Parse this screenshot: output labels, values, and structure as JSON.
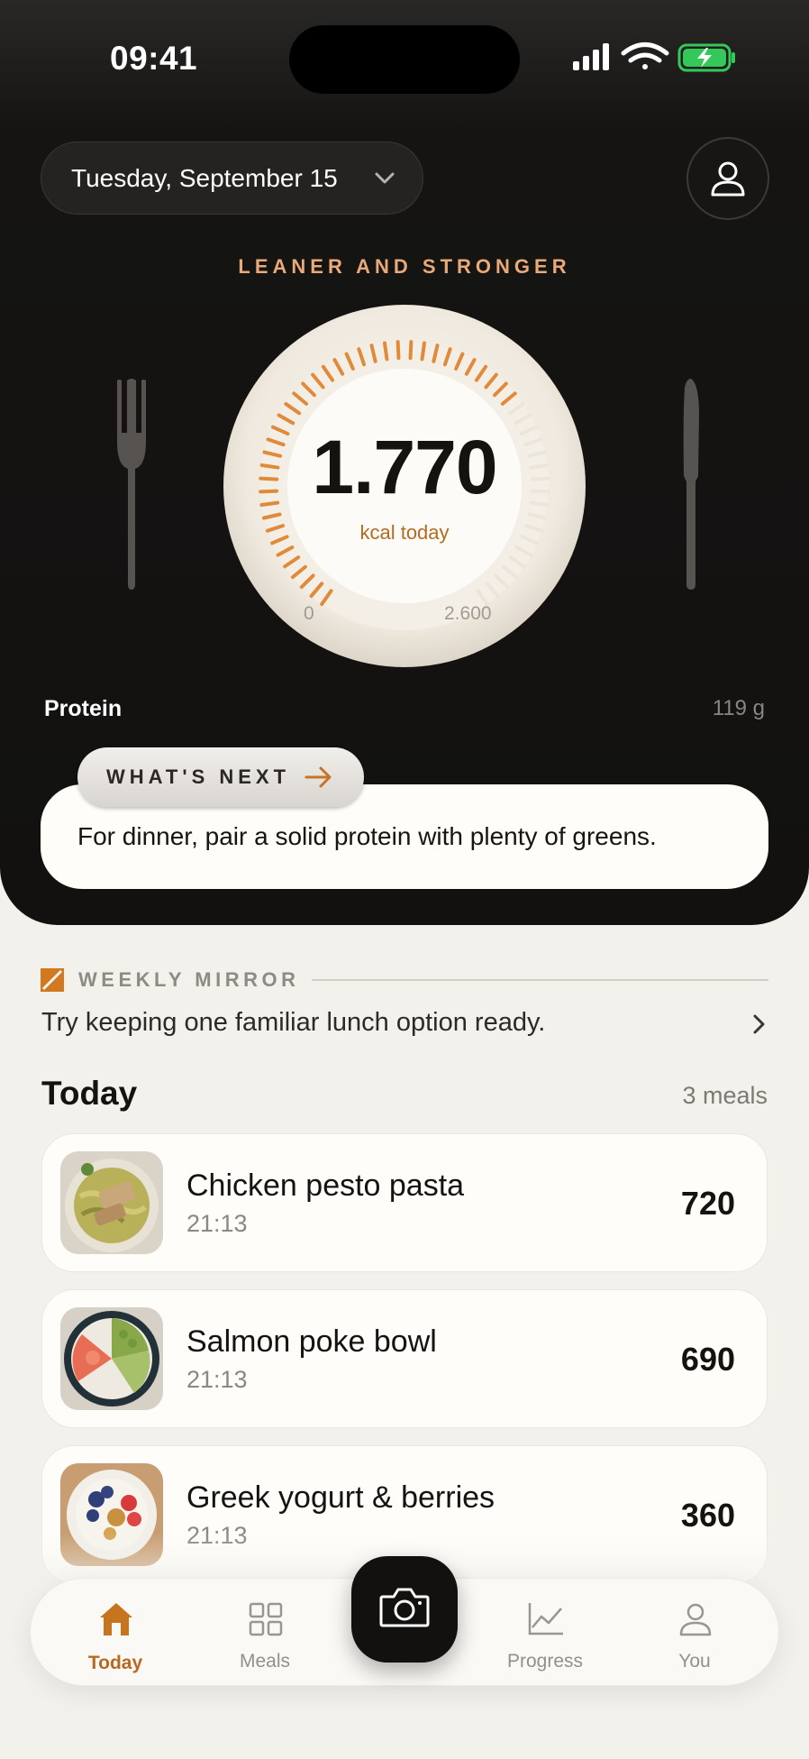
{
  "status_bar": {
    "time": "09:41"
  },
  "header": {
    "date": "Tuesday, September 15",
    "goal_label": "LEANER AND STRONGER"
  },
  "calories": {
    "value": "1.770",
    "unit": "kcal today",
    "scale_min": "0",
    "scale_max": "2.600",
    "progress_fraction": 0.68
  },
  "protein": {
    "label": "Protein",
    "value": "119 g"
  },
  "whats_next": {
    "tab_label": "WHAT'S NEXT",
    "text": "For dinner, pair a solid protein with plenty of greens."
  },
  "weekly_mirror": {
    "label": "WEEKLY MIRROR",
    "text": "Try keeping one familiar lunch option ready."
  },
  "today": {
    "title": "Today",
    "count": "3 meals",
    "meals": [
      {
        "name": "Chicken pesto pasta",
        "time": "21:13",
        "kcal": "720"
      },
      {
        "name": "Salmon poke bowl",
        "time": "21:13",
        "kcal": "690"
      },
      {
        "name": "Greek yogurt & berries",
        "time": "21:13",
        "kcal": "360"
      }
    ]
  },
  "nav": {
    "items": [
      {
        "label": "Today",
        "icon": "home-icon",
        "active": true
      },
      {
        "label": "Meals",
        "icon": "grid-icon"
      },
      {
        "label": "Progress",
        "icon": "chart-icon"
      },
      {
        "label": "You",
        "icon": "person-icon"
      }
    ],
    "camera_icon": "camera-icon"
  },
  "colors": {
    "accent": "#b8691e",
    "goal": "#e9a979",
    "battery": "#34c759"
  }
}
